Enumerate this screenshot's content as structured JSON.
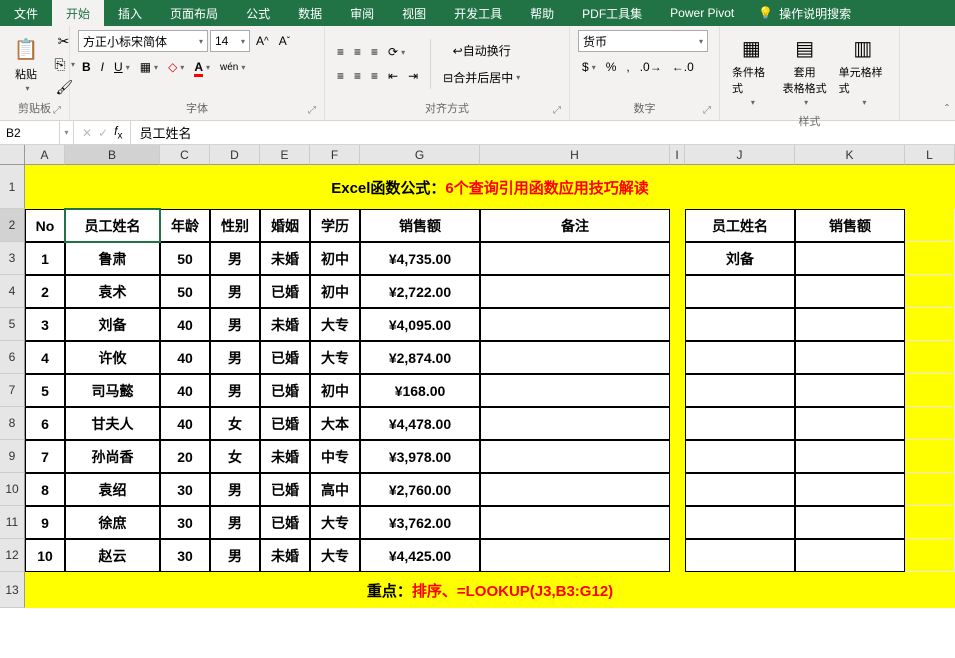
{
  "tabs": {
    "file": "文件",
    "home": "开始",
    "insert": "插入",
    "layout": "页面布局",
    "formulas": "公式",
    "data": "数据",
    "review": "审阅",
    "view": "视图",
    "dev": "开发工具",
    "help": "帮助",
    "pdf": "PDF工具集",
    "pivot": "Power Pivot",
    "tellme": "操作说明搜索"
  },
  "groups": {
    "clipboard": "剪贴板",
    "font": "字体",
    "align": "对齐方式",
    "number": "数字",
    "styles": "样式"
  },
  "font": {
    "name": "方正小标宋简体",
    "size": "14"
  },
  "align": {
    "wrap": "自动换行",
    "merge": "合并后居中"
  },
  "number": {
    "format": "货币"
  },
  "styles": {
    "cond": "条件格式",
    "table": "套用\n表格格式",
    "cell": "单元格样式"
  },
  "namebox": "B2",
  "formula": "员工姓名",
  "cols": [
    "A",
    "B",
    "C",
    "D",
    "E",
    "F",
    "G",
    "H",
    "I",
    "J",
    "K",
    "L"
  ],
  "title_prefix": "Excel函数公式：",
  "title_suffix": "6个查询引用函数应用技巧解读",
  "headers": {
    "no": "No",
    "name": "员工姓名",
    "age": "年龄",
    "sex": "性别",
    "marriage": "婚姻",
    "edu": "学历",
    "sales": "销售额",
    "remark": "备注"
  },
  "right_headers": {
    "name": "员工姓名",
    "sales": "销售额"
  },
  "right_data": {
    "name": "刘备"
  },
  "rows": [
    {
      "no": "1",
      "name": "鲁肃",
      "age": "50",
      "sex": "男",
      "marriage": "未婚",
      "edu": "初中",
      "sales": "¥4,735.00"
    },
    {
      "no": "2",
      "name": "袁术",
      "age": "50",
      "sex": "男",
      "marriage": "已婚",
      "edu": "初中",
      "sales": "¥2,722.00"
    },
    {
      "no": "3",
      "name": "刘备",
      "age": "40",
      "sex": "男",
      "marriage": "未婚",
      "edu": "大专",
      "sales": "¥4,095.00"
    },
    {
      "no": "4",
      "name": "许攸",
      "age": "40",
      "sex": "男",
      "marriage": "已婚",
      "edu": "大专",
      "sales": "¥2,874.00"
    },
    {
      "no": "5",
      "name": "司马懿",
      "age": "40",
      "sex": "男",
      "marriage": "已婚",
      "edu": "初中",
      "sales": "¥168.00"
    },
    {
      "no": "6",
      "name": "甘夫人",
      "age": "40",
      "sex": "女",
      "marriage": "已婚",
      "edu": "大本",
      "sales": "¥4,478.00"
    },
    {
      "no": "7",
      "name": "孙尚香",
      "age": "20",
      "sex": "女",
      "marriage": "未婚",
      "edu": "中专",
      "sales": "¥3,978.00"
    },
    {
      "no": "8",
      "name": "袁绍",
      "age": "30",
      "sex": "男",
      "marriage": "已婚",
      "edu": "高中",
      "sales": "¥2,760.00"
    },
    {
      "no": "9",
      "name": "徐庶",
      "age": "30",
      "sex": "男",
      "marriage": "已婚",
      "edu": "大专",
      "sales": "¥3,762.00"
    },
    {
      "no": "10",
      "name": "赵云",
      "age": "30",
      "sex": "男",
      "marriage": "未婚",
      "edu": "大专",
      "sales": "¥4,425.00"
    }
  ],
  "footer_prefix": "重点：",
  "footer_suffix": "排序、=LOOKUP(J3,B3:G12)"
}
